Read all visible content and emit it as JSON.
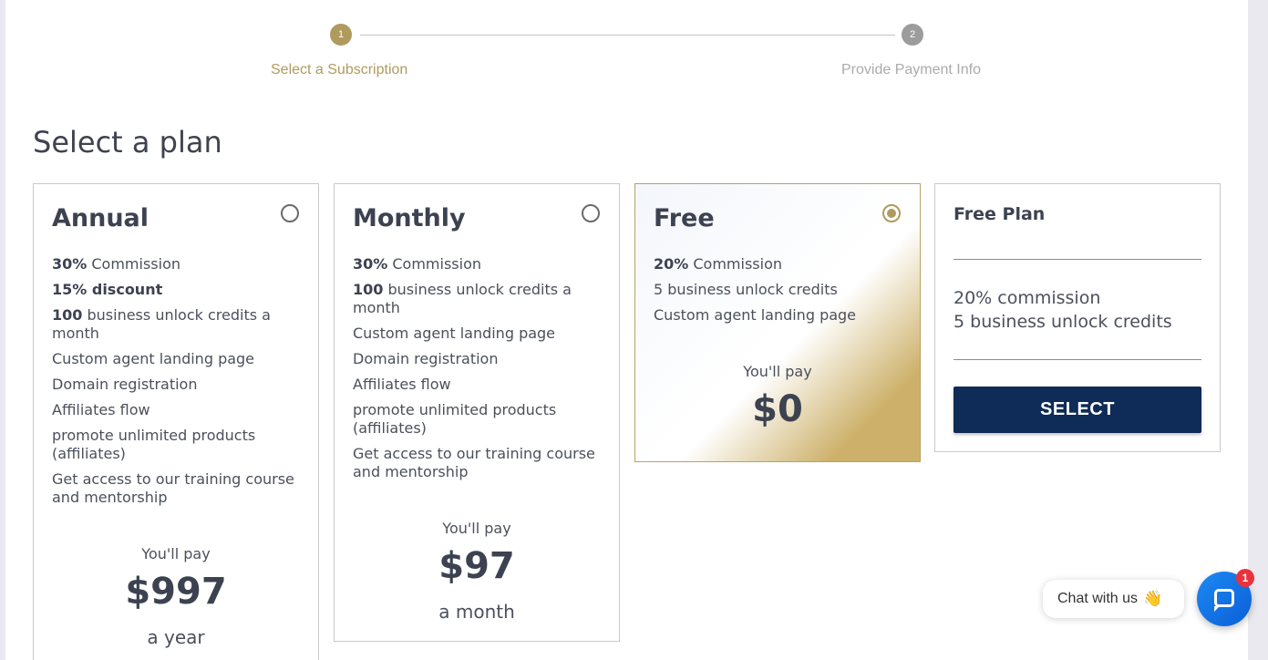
{
  "stepper": {
    "steps": [
      {
        "number": "1",
        "label": "Select a Subscription",
        "state": "active"
      },
      {
        "number": "2",
        "label": "Provide Payment Info",
        "state": "inactive"
      }
    ]
  },
  "heading": "Select a plan",
  "plans": [
    {
      "title": "Annual",
      "selected": false,
      "features": [
        {
          "bold": "30%",
          "text": " Commission"
        },
        {
          "bold": "15% discount",
          "text": ""
        },
        {
          "bold": "100",
          "text": " business unlock credits a month"
        },
        {
          "bold": "",
          "text": "Custom agent landing page"
        },
        {
          "bold": "",
          "text": "Domain registration"
        },
        {
          "bold": "",
          "text": "Affiliates flow"
        },
        {
          "bold": "",
          "text": "promote unlimited products (affiliates)"
        },
        {
          "bold": "",
          "text": "Get access to our training course and mentorship"
        }
      ],
      "pay_label": "You'll pay",
      "price": "$997",
      "period": "a year"
    },
    {
      "title": "Monthly",
      "selected": false,
      "features": [
        {
          "bold": "30%",
          "text": " Commission"
        },
        {
          "bold": "100",
          "text": " business unlock credits a month"
        },
        {
          "bold": "",
          "text": "Custom agent landing page"
        },
        {
          "bold": "",
          "text": "Domain registration"
        },
        {
          "bold": "",
          "text": "Affiliates flow"
        },
        {
          "bold": "",
          "text": "promote unlimited products (affiliates)"
        },
        {
          "bold": "",
          "text": "Get access to our training course and mentorship"
        }
      ],
      "pay_label": "You'll pay",
      "price": "$97",
      "period": "a month"
    },
    {
      "title": "Free",
      "selected": true,
      "features": [
        {
          "bold": "20%",
          "text": " Commission"
        },
        {
          "bold": "",
          "text": "5 business unlock credits"
        },
        {
          "bold": "",
          "text": "Custom agent landing page"
        }
      ],
      "pay_label": "You'll pay",
      "price": "$0",
      "period": ""
    }
  ],
  "summary": {
    "title": "Free Plan",
    "lines": [
      "20% commission",
      "5 business unlock credits"
    ],
    "button_label": "SELECT"
  },
  "chat": {
    "label": "Chat with us",
    "badge": "1"
  },
  "colors": {
    "accent": "#b09a5e",
    "button": "#0f2b57",
    "chat_button": "#1d89f2",
    "badge": "#e8333c"
  }
}
